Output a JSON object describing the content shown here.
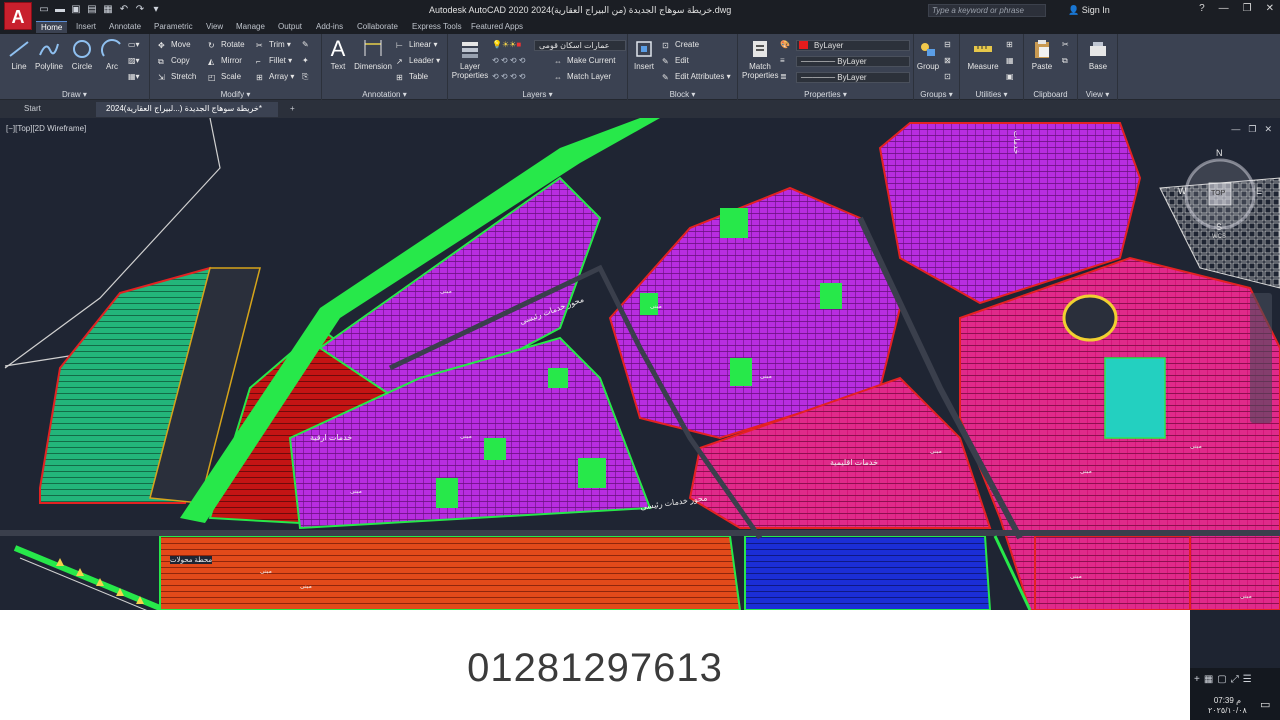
{
  "app": {
    "logo_letter": "A",
    "title": "Autodesk AutoCAD 2020   2024خريطة سوهاج الجديدة (من البيراج العقارية).dwg",
    "search_placeholder": "Type a keyword or phrase",
    "sign_in": "Sign In"
  },
  "ribbon_tabs": [
    "Home",
    "Insert",
    "Annotate",
    "Parametric",
    "View",
    "Manage",
    "Output",
    "Add-ins",
    "Collaborate",
    "Express Tools",
    "Featured Apps"
  ],
  "ribbon": {
    "draw": {
      "title": "Draw",
      "line": "Line",
      "polyline": "Polyline",
      "circle": "Circle",
      "arc": "Arc"
    },
    "modify": {
      "title": "Modify",
      "move": "Move",
      "rotate": "Rotate",
      "trim": "Trim",
      "copy": "Copy",
      "mirror": "Mirror",
      "fillet": "Fillet",
      "stretch": "Stretch",
      "scale": "Scale",
      "array": "Array"
    },
    "annotation": {
      "title": "Annotation",
      "text": "Text",
      "dimension": "Dimension",
      "linear": "Linear",
      "leader": "Leader",
      "table": "Table"
    },
    "layers": {
      "title": "Layers",
      "layer_properties": "Layer Properties",
      "current_layer": "عمارات اسكان قومى",
      "make_current": "Make Current",
      "match_layer": "Match Layer"
    },
    "block": {
      "title": "Block",
      "insert": "Insert",
      "create": "Create",
      "edit": "Edit",
      "edit_attributes": "Edit Attributes"
    },
    "properties": {
      "title": "Properties",
      "match_properties": "Match Properties",
      "color": "ByLayer",
      "linetype": "ByLayer",
      "lineweight": "ByLayer"
    },
    "groups": {
      "title": "Groups",
      "group": "Group"
    },
    "utilities": {
      "title": "Utilities",
      "measure": "Measure"
    },
    "clipboard": {
      "title": "Clipboard",
      "paste": "Paste"
    },
    "view": {
      "title": "View",
      "base": "Base"
    }
  },
  "file_tabs": {
    "start": "Start",
    "current": "خريطة سوهاج الجديدة (...لبيراج العقارية)2024*"
  },
  "viewport": {
    "label": "[−][Top][2D Wireframe]",
    "viewcube": {
      "n": "N",
      "s": "S",
      "w": "W",
      "e": "E",
      "top": "TOP",
      "wcs": "WCS"
    }
  },
  "map_labels": {
    "main_road_1": "محور خدمات رئيسى",
    "main_road_2": "محور خدمات رئيسى",
    "services_1": "خدمات ارقية",
    "services_2": "خدمات اقليمية",
    "services_3": "خدمات",
    "station": "محطة محولات"
  },
  "overlay": {
    "phone": "01281297613"
  },
  "taskbar": {
    "time": "07:39 م",
    "date": "٢٠٢٥/١٠/٠٨"
  },
  "colors": {
    "ribbon": "#3b4252",
    "drawing_bg": "#1f2533",
    "magenta": "#d6177a",
    "violet": "#b82de0",
    "green": "#27e84a",
    "orange": "#e8561c",
    "blue": "#1b2ed6"
  }
}
